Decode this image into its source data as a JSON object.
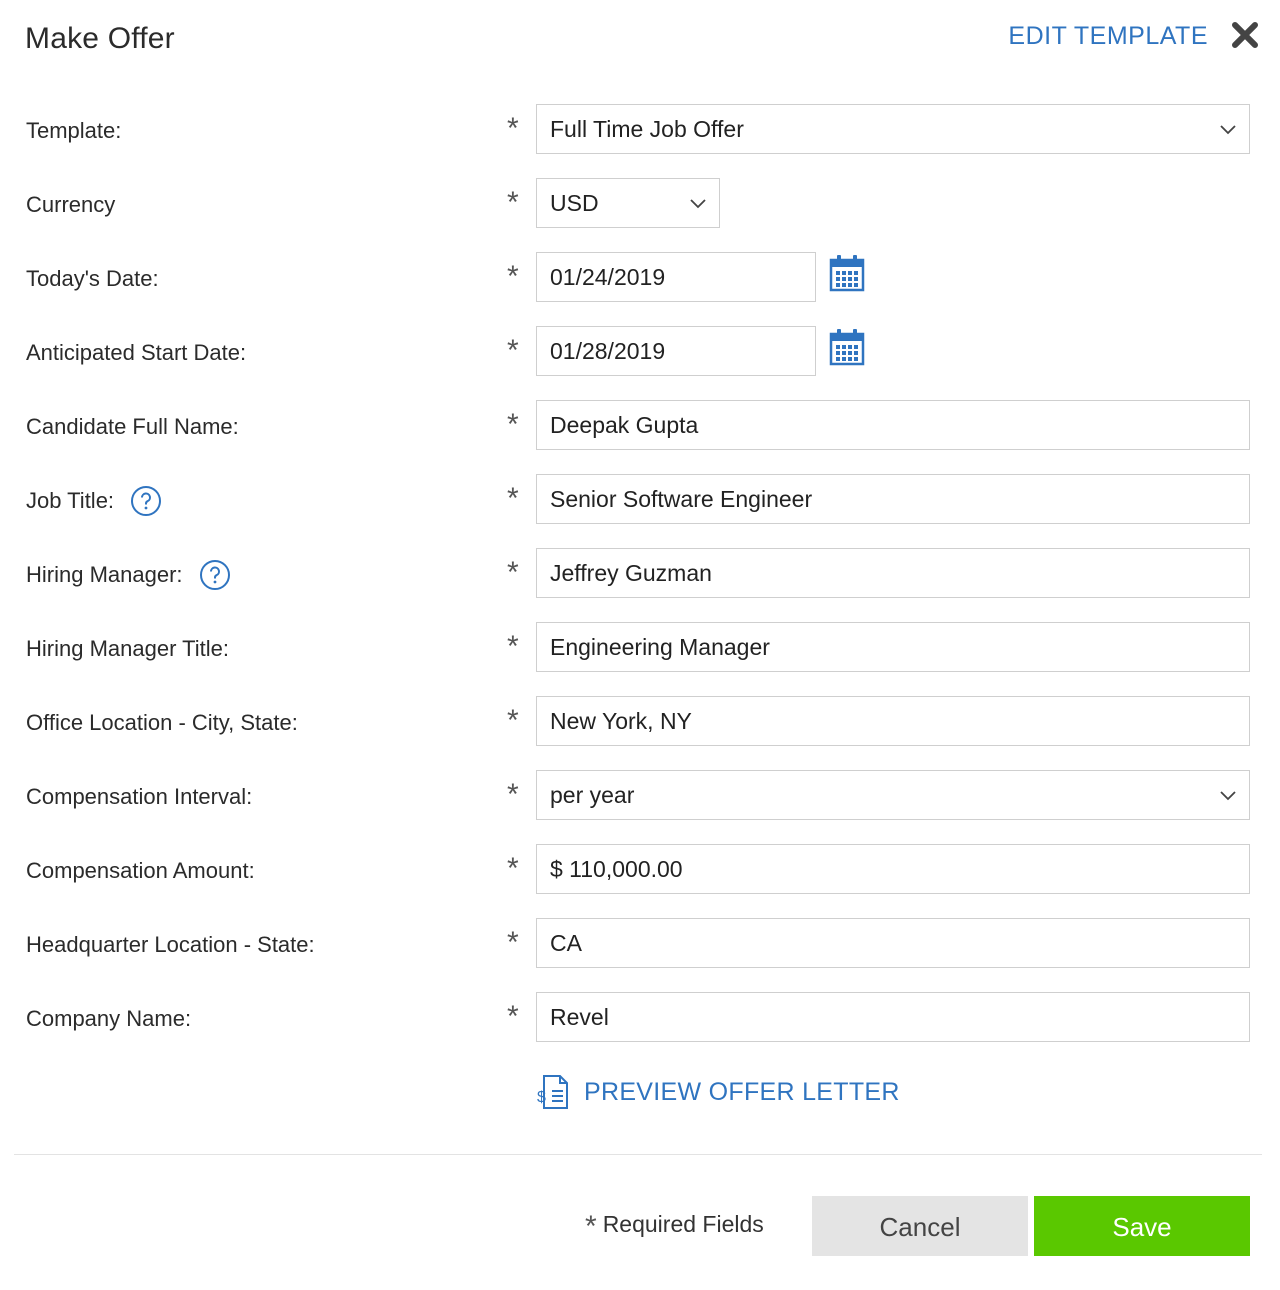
{
  "header": {
    "title": "Make Offer",
    "edit_template_label": "EDIT TEMPLATE",
    "close_icon": "close-icon"
  },
  "form": {
    "required_marker": "*",
    "fields": {
      "template": {
        "label": "Template:",
        "value": "Full Time Job Offer"
      },
      "currency": {
        "label": "Currency",
        "value": "USD"
      },
      "todays_date": {
        "label": "Today's Date:",
        "value": "01/24/2019"
      },
      "start_date": {
        "label": "Anticipated Start Date:",
        "value": "01/28/2019"
      },
      "candidate_name": {
        "label": "Candidate Full Name:",
        "value": "Deepak Gupta"
      },
      "job_title": {
        "label": "Job Title:",
        "value": "Senior Software Engineer"
      },
      "hiring_manager": {
        "label": "Hiring Manager:",
        "value": "Jeffrey Guzman"
      },
      "hiring_manager_title": {
        "label": "Hiring Manager Title:",
        "value": "Engineering Manager"
      },
      "office_location": {
        "label": "Office Location - City, State:",
        "value": "New York, NY"
      },
      "comp_interval": {
        "label": "Compensation Interval:",
        "value": "per year"
      },
      "comp_amount": {
        "label": "Compensation Amount:",
        "value": "$ 110,000.00"
      },
      "hq_location": {
        "label": "Headquarter Location - State:",
        "value": "CA"
      },
      "company_name": {
        "label": "Company Name:",
        "value": "Revel"
      }
    }
  },
  "preview": {
    "label": "PREVIEW OFFER LETTER"
  },
  "footer": {
    "required_note": "Required Fields",
    "cancel_label": "Cancel",
    "save_label": "Save"
  },
  "colors": {
    "link": "#2f74c0",
    "save": "#5ac800",
    "cancel": "#e4e4e4"
  }
}
